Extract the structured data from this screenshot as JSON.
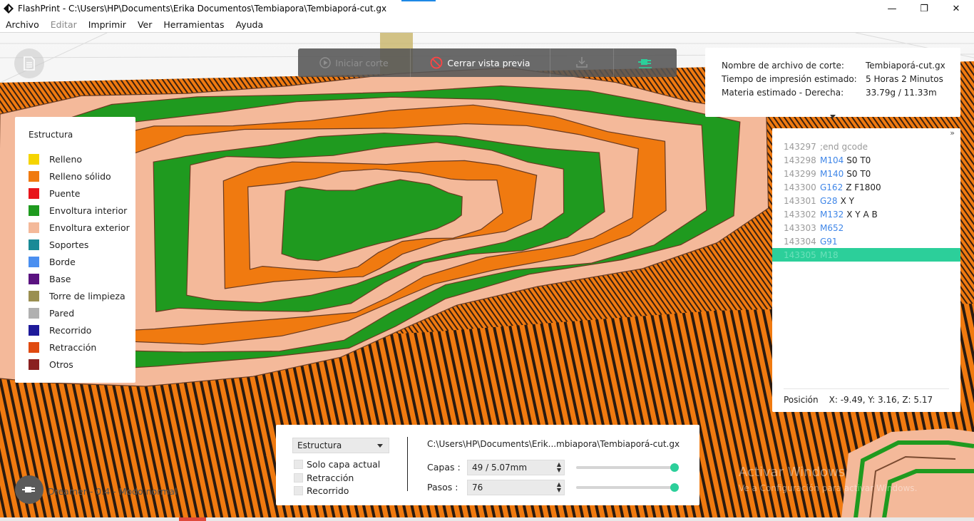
{
  "window": {
    "title": "FlashPrint - C:\\Users\\HP\\Documents\\Erika Documentos\\Tembiapora\\Tembiaporá-cut.gx",
    "minimize_glyph": "—",
    "maximize_glyph": "❐",
    "close_glyph": "✕"
  },
  "menu": {
    "items": [
      "Archivo",
      "Editar",
      "Imprimir",
      "Ver",
      "Herramientas",
      "Ayuda"
    ]
  },
  "toolbar": {
    "start_slice": "Iniciar corte",
    "close_preview": "Cerrar vista previa"
  },
  "info": {
    "rows": [
      {
        "label": "Nombre de archivo de corte:",
        "value": "Tembiaporá-cut.gx"
      },
      {
        "label": "Tiempo de impresión estimado:",
        "value": "5 Horas 2 Minutos"
      },
      {
        "label": "Materia estimado - Derecha:",
        "value": "33.79g / 11.33m"
      }
    ]
  },
  "gcode": {
    "collapse_glyph": "»",
    "lines": [
      {
        "num": "143297",
        "cmd": "",
        "args": ";end gcode"
      },
      {
        "num": "143298",
        "cmd": "M104",
        "args": "S0 T0"
      },
      {
        "num": "143299",
        "cmd": "M140",
        "args": "S0 T0"
      },
      {
        "num": "143300",
        "cmd": "G162",
        "args": "Z F1800"
      },
      {
        "num": "143301",
        "cmd": "G28",
        "args": "X Y"
      },
      {
        "num": "143302",
        "cmd": "M132",
        "args": "X Y A B"
      },
      {
        "num": "143303",
        "cmd": "M652",
        "args": ""
      },
      {
        "num": "143304",
        "cmd": "G91",
        "args": ""
      },
      {
        "num": "143305",
        "cmd": "M18",
        "args": ""
      }
    ],
    "position_label": "Posición",
    "position_value": "X: -9.49, Y: 3.16, Z: 5.17"
  },
  "legend": {
    "title": "Estructura",
    "items": [
      {
        "label": "Relleno",
        "color": "#f5d400"
      },
      {
        "label": "Relleno sólido",
        "color": "#f07a10"
      },
      {
        "label": "Puente",
        "color": "#e8141b"
      },
      {
        "label": "Envoltura interior",
        "color": "#1f9a1f"
      },
      {
        "label": "Envoltura exterior",
        "color": "#f4b99a"
      },
      {
        "label": "Soportes",
        "color": "#198a96"
      },
      {
        "label": "Borde",
        "color": "#4a8ff0"
      },
      {
        "label": "Base",
        "color": "#5a1280"
      },
      {
        "label": "Torre de limpieza",
        "color": "#9a8f50"
      },
      {
        "label": "Pared",
        "color": "#b0b0b0"
      },
      {
        "label": "Recorrido",
        "color": "#1e1a9a"
      },
      {
        "label": "Retracción",
        "color": "#e04a10"
      },
      {
        "label": "Otros",
        "color": "#8a2020"
      }
    ]
  },
  "controls": {
    "view_mode": "Estructura",
    "checkboxes": [
      "Solo capa actual",
      "Retracción",
      "Recorrido"
    ],
    "file_path": "C:\\Users\\HP\\Documents\\Erik...mbiapora\\Tembiaporá-cut.gx",
    "layers_label": "Capas :",
    "layers_value": "49 / 5.07mm",
    "steps_label": "Pasos :",
    "steps_value": "76",
    "layers_slider": 1.0,
    "steps_slider": 1.0
  },
  "status": {
    "text": "Dreamer - 0.4 - Modo normal"
  },
  "watermark": {
    "title": "Activar Windows",
    "subtitle": "Ve a Configuración para activar Windows."
  },
  "colors": {
    "accent": "#2ccf9a",
    "orange": "#f07a10",
    "green": "#1f9a1f",
    "shell": "#f4b99a"
  }
}
